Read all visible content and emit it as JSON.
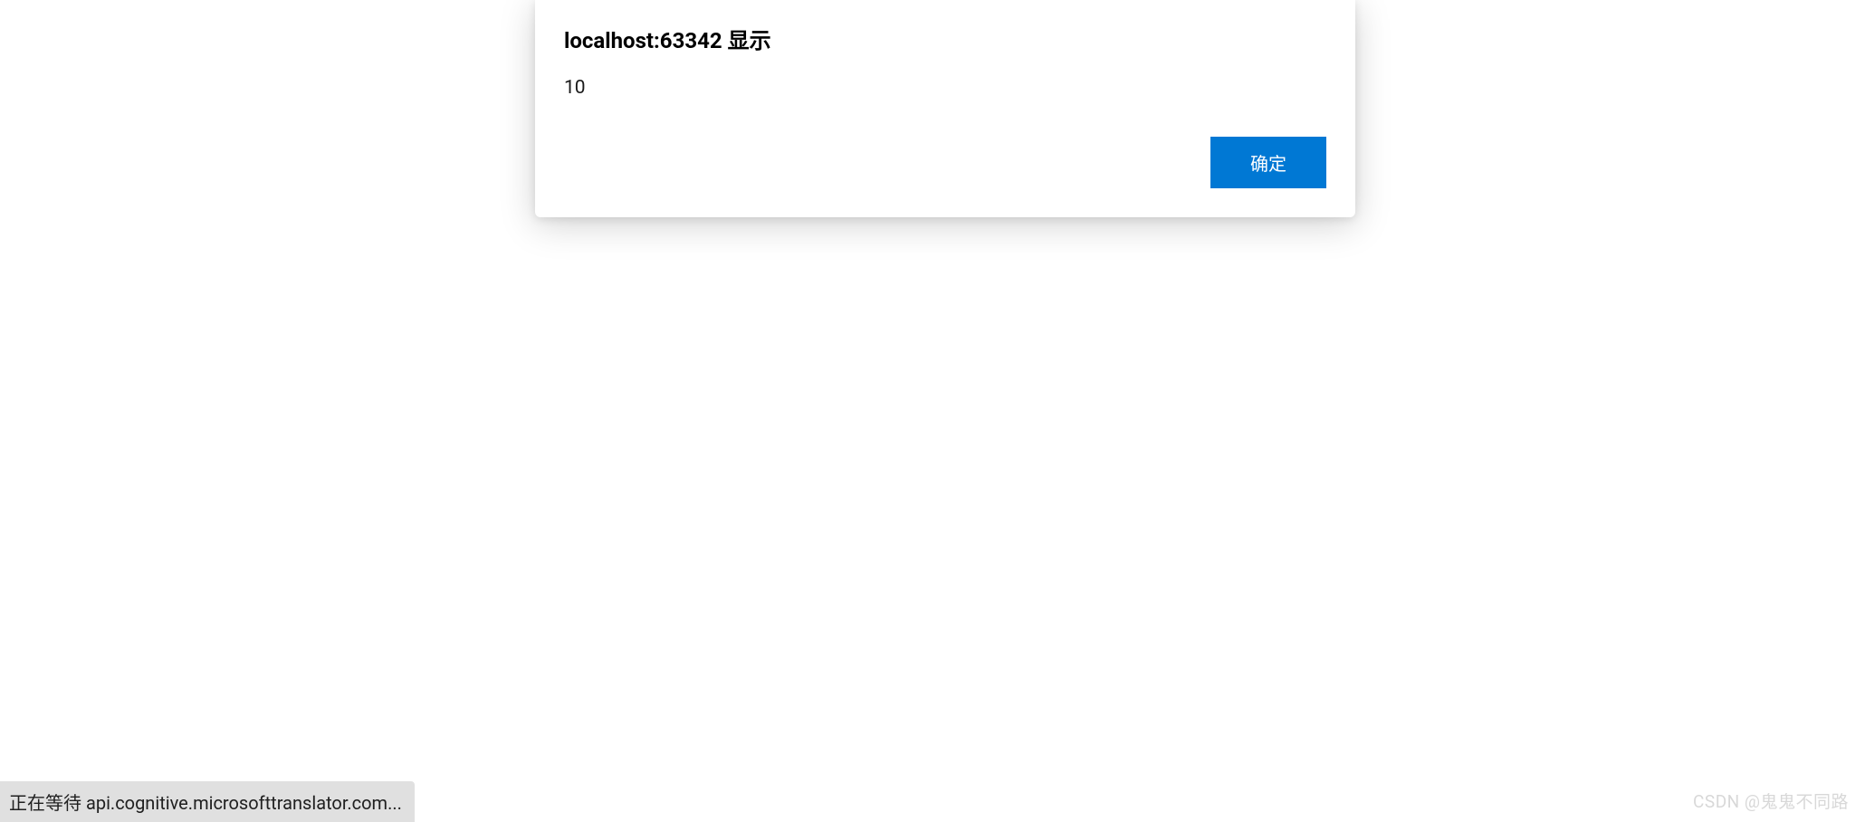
{
  "dialog": {
    "title": "localhost:63342 显示",
    "message": "10",
    "ok_label": "确定"
  },
  "status_bar": {
    "text": "正在等待 api.cognitive.microsofttranslator.com..."
  },
  "watermark": {
    "text": "CSDN @鬼鬼不同路"
  }
}
